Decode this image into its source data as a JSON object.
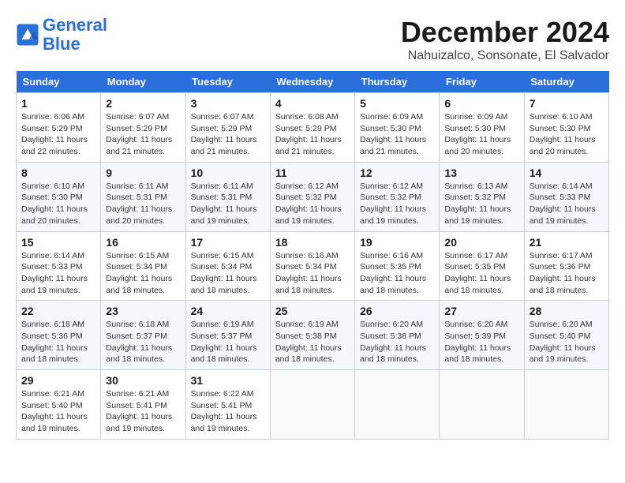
{
  "header": {
    "logo_line1": "General",
    "logo_line2": "Blue",
    "month_title": "December 2024",
    "location": "Nahuizalco, Sonsonate, El Salvador"
  },
  "weekdays": [
    "Sunday",
    "Monday",
    "Tuesday",
    "Wednesday",
    "Thursday",
    "Friday",
    "Saturday"
  ],
  "weeks": [
    [
      {
        "day": "1",
        "info": "Sunrise: 6:06 AM\nSunset: 5:29 PM\nDaylight: 11 hours\nand 22 minutes."
      },
      {
        "day": "2",
        "info": "Sunrise: 6:07 AM\nSunset: 5:29 PM\nDaylight: 11 hours\nand 21 minutes."
      },
      {
        "day": "3",
        "info": "Sunrise: 6:07 AM\nSunset: 5:29 PM\nDaylight: 11 hours\nand 21 minutes."
      },
      {
        "day": "4",
        "info": "Sunrise: 6:08 AM\nSunset: 5:29 PM\nDaylight: 11 hours\nand 21 minutes."
      },
      {
        "day": "5",
        "info": "Sunrise: 6:09 AM\nSunset: 5:30 PM\nDaylight: 11 hours\nand 21 minutes."
      },
      {
        "day": "6",
        "info": "Sunrise: 6:09 AM\nSunset: 5:30 PM\nDaylight: 11 hours\nand 20 minutes."
      },
      {
        "day": "7",
        "info": "Sunrise: 6:10 AM\nSunset: 5:30 PM\nDaylight: 11 hours\nand 20 minutes."
      }
    ],
    [
      {
        "day": "8",
        "info": "Sunrise: 6:10 AM\nSunset: 5:30 PM\nDaylight: 11 hours\nand 20 minutes."
      },
      {
        "day": "9",
        "info": "Sunrise: 6:11 AM\nSunset: 5:31 PM\nDaylight: 11 hours\nand 20 minutes."
      },
      {
        "day": "10",
        "info": "Sunrise: 6:11 AM\nSunset: 5:31 PM\nDaylight: 11 hours\nand 19 minutes."
      },
      {
        "day": "11",
        "info": "Sunrise: 6:12 AM\nSunset: 5:32 PM\nDaylight: 11 hours\nand 19 minutes."
      },
      {
        "day": "12",
        "info": "Sunrise: 6:12 AM\nSunset: 5:32 PM\nDaylight: 11 hours\nand 19 minutes."
      },
      {
        "day": "13",
        "info": "Sunrise: 6:13 AM\nSunset: 5:32 PM\nDaylight: 11 hours\nand 19 minutes."
      },
      {
        "day": "14",
        "info": "Sunrise: 6:14 AM\nSunset: 5:33 PM\nDaylight: 11 hours\nand 19 minutes."
      }
    ],
    [
      {
        "day": "15",
        "info": "Sunrise: 6:14 AM\nSunset: 5:33 PM\nDaylight: 11 hours\nand 19 minutes."
      },
      {
        "day": "16",
        "info": "Sunrise: 6:15 AM\nSunset: 5:34 PM\nDaylight: 11 hours\nand 18 minutes."
      },
      {
        "day": "17",
        "info": "Sunrise: 6:15 AM\nSunset: 5:34 PM\nDaylight: 11 hours\nand 18 minutes."
      },
      {
        "day": "18",
        "info": "Sunrise: 6:16 AM\nSunset: 5:34 PM\nDaylight: 11 hours\nand 18 minutes."
      },
      {
        "day": "19",
        "info": "Sunrise: 6:16 AM\nSunset: 5:35 PM\nDaylight: 11 hours\nand 18 minutes."
      },
      {
        "day": "20",
        "info": "Sunrise: 6:17 AM\nSunset: 5:35 PM\nDaylight: 11 hours\nand 18 minutes."
      },
      {
        "day": "21",
        "info": "Sunrise: 6:17 AM\nSunset: 5:36 PM\nDaylight: 11 hours\nand 18 minutes."
      }
    ],
    [
      {
        "day": "22",
        "info": "Sunrise: 6:18 AM\nSunset: 5:36 PM\nDaylight: 11 hours\nand 18 minutes."
      },
      {
        "day": "23",
        "info": "Sunrise: 6:18 AM\nSunset: 5:37 PM\nDaylight: 11 hours\nand 18 minutes."
      },
      {
        "day": "24",
        "info": "Sunrise: 6:19 AM\nSunset: 5:37 PM\nDaylight: 11 hours\nand 18 minutes."
      },
      {
        "day": "25",
        "info": "Sunrise: 6:19 AM\nSunset: 5:38 PM\nDaylight: 11 hours\nand 18 minutes."
      },
      {
        "day": "26",
        "info": "Sunrise: 6:20 AM\nSunset: 5:38 PM\nDaylight: 11 hours\nand 18 minutes."
      },
      {
        "day": "27",
        "info": "Sunrise: 6:20 AM\nSunset: 5:39 PM\nDaylight: 11 hours\nand 18 minutes."
      },
      {
        "day": "28",
        "info": "Sunrise: 6:20 AM\nSunset: 5:40 PM\nDaylight: 11 hours\nand 19 minutes."
      }
    ],
    [
      {
        "day": "29",
        "info": "Sunrise: 6:21 AM\nSunset: 5:40 PM\nDaylight: 11 hours\nand 19 minutes."
      },
      {
        "day": "30",
        "info": "Sunrise: 6:21 AM\nSunset: 5:41 PM\nDaylight: 11 hours\nand 19 minutes."
      },
      {
        "day": "31",
        "info": "Sunrise: 6:22 AM\nSunset: 5:41 PM\nDaylight: 11 hours\nand 19 minutes."
      },
      {
        "day": "",
        "info": ""
      },
      {
        "day": "",
        "info": ""
      },
      {
        "day": "",
        "info": ""
      },
      {
        "day": "",
        "info": ""
      }
    ]
  ]
}
